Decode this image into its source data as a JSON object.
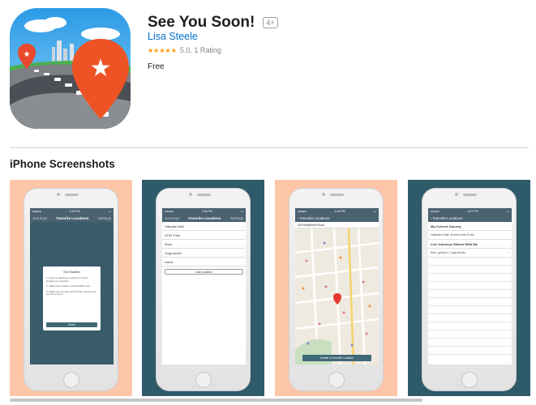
{
  "app": {
    "title": "See You Soon!",
    "age_rating": "4+",
    "developer": "Lisa Steele",
    "stars": "★★★★★",
    "rating_text": "5.0, 1 Rating",
    "price": "Free"
  },
  "section": {
    "title": "iPhone Screenshots"
  },
  "colors": {
    "peach": "#fdc6a8",
    "teal": "#2f5a6a",
    "accent": "#3f6878",
    "link": "#0070c9"
  },
  "screenshots": [
    {
      "status_time": "4:18 PM",
      "nav": [
        "Journeys",
        "Favorite Locations",
        "Settings"
      ],
      "dialog": {
        "title": "Get Started",
        "steps": [
          "1. Input an address or add your current location as a favorite",
          "2. Swipe left to share it with another user",
          "3. Share your journey and let them know you'll see them soon!"
        ],
        "close": "Close"
      }
    },
    {
      "status_time": "7:36 PM",
      "nav": [
        "Journeys",
        "Favorite Locations",
        "Settings"
      ],
      "rows": [
        "Hillsdale Mall",
        "AT&T Park",
        "Work",
        "Yoga studio",
        "Home"
      ],
      "add_button": "Add Location"
    },
    {
      "status_time": "4:18 PM",
      "nav_back": "Favorite Locations",
      "address": "635 Middlefield Road",
      "create_button": "Create a Favorite Location"
    },
    {
      "status_time": "4:07 PM",
      "nav_back": "Favorite Locations",
      "current_heading": "My Current Journey",
      "current_row": "Hillsdale Mall: shared with Emie",
      "shared_heading": "Live Journeys Shared With Me",
      "shared_row": "Bert: going to Yoga studio"
    }
  ]
}
